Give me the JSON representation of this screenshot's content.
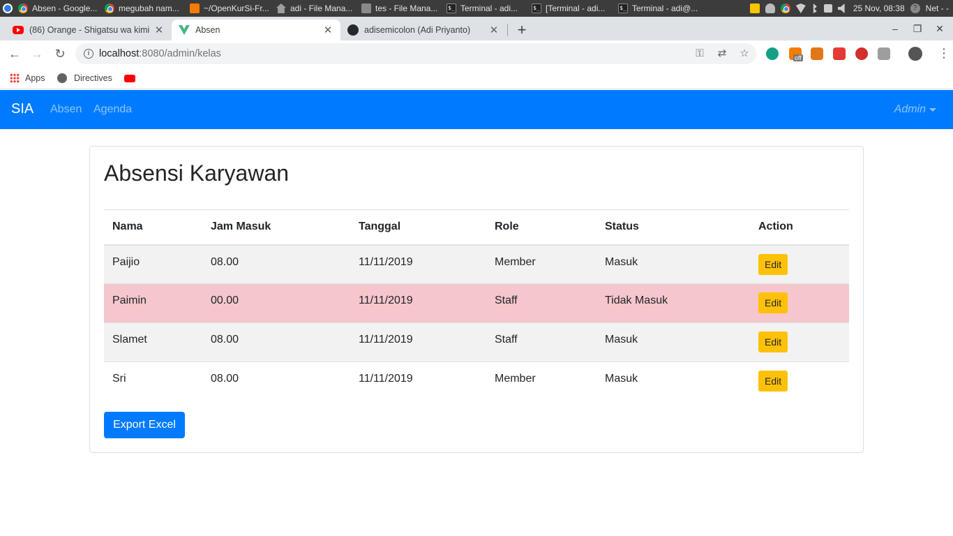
{
  "taskbar": {
    "windows": [
      {
        "label": "Absen - Google..."
      },
      {
        "label": "megubah nam..."
      },
      {
        "label": "~/OpenKurSi-Fr..."
      },
      {
        "label": "adi - File Mana..."
      },
      {
        "label": "tes - File Mana..."
      },
      {
        "label": "Terminal - adi..."
      },
      {
        "label": "[Terminal - adi..."
      },
      {
        "label": "Terminal - adi@..."
      }
    ],
    "clock": "25 Nov, 08:38",
    "net_label": "Net - -"
  },
  "browser": {
    "tabs": [
      {
        "title": "(86) Orange - Shigatsu wa kimi"
      },
      {
        "title": "Absen"
      },
      {
        "title": "adisemicolon (Adi Priyanto)"
      }
    ],
    "url_host": "localhost",
    "url_path": ":8080/admin/kelas",
    "bookmarks": {
      "apps": "Apps",
      "directives": "Directives"
    },
    "extension_badge": "off"
  },
  "navbar": {
    "brand": "SIA",
    "links": [
      "Absen",
      "Agenda"
    ],
    "user": "Admin"
  },
  "page": {
    "title": "Absensi Karyawan",
    "columns": [
      "Nama",
      "Jam Masuk",
      "Tanggal",
      "Role",
      "Status",
      "Action"
    ],
    "rows": [
      {
        "nama": "Paijio",
        "jam": "08.00",
        "tanggal": "11/11/2019",
        "role": "Member",
        "status": "Masuk",
        "action": "Edit"
      },
      {
        "nama": "Paimin",
        "jam": "00.00",
        "tanggal": "11/11/2019",
        "role": "Staff",
        "status": "Tidak Masuk",
        "action": "Edit"
      },
      {
        "nama": "Slamet",
        "jam": "08.00",
        "tanggal": "11/11/2019",
        "role": "Staff",
        "status": "Masuk",
        "action": "Edit"
      },
      {
        "nama": "Sri",
        "jam": "08.00",
        "tanggal": "11/11/2019",
        "role": "Member",
        "status": "Masuk",
        "action": "Edit"
      }
    ],
    "export_label": "Export Excel"
  },
  "colors": {
    "primary": "#007bff",
    "warning": "#ffc107",
    "danger_row": "#f5c6cb",
    "stripe": "#f2f2f2"
  }
}
